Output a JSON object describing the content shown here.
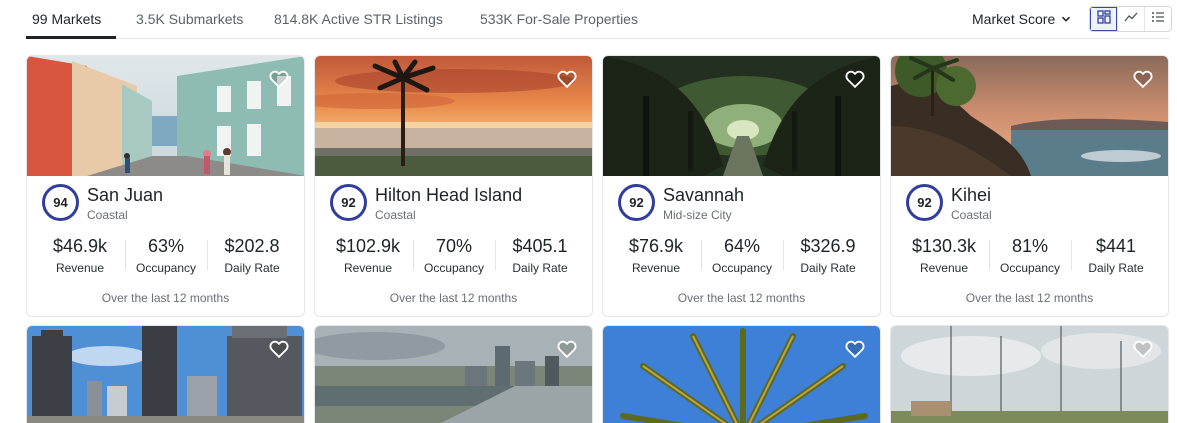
{
  "tabs": [
    {
      "label": "99 Markets"
    },
    {
      "label": "3.5K Submarkets"
    },
    {
      "label": "814.8K Active STR Listings"
    },
    {
      "label": "533K For-Sale Properties"
    }
  ],
  "sort": {
    "label": "Market Score"
  },
  "view_buttons": [
    {
      "icon": "grid-icon",
      "active": true
    },
    {
      "icon": "trend-chart-icon",
      "active": false
    },
    {
      "icon": "list-icon",
      "active": false
    }
  ],
  "stat_labels": {
    "revenue": "Revenue",
    "occupancy": "Occupancy",
    "daily_rate": "Daily Rate"
  },
  "markets": [
    {
      "score": "94",
      "name": "San Juan",
      "type": "Coastal",
      "revenue": "$46.9k",
      "occupancy": "63%",
      "daily_rate": "$202.8",
      "period": "Over the last 12 months",
      "photo": "street-photo"
    },
    {
      "score": "92",
      "name": "Hilton Head Island",
      "type": "Coastal",
      "revenue": "$102.9k",
      "occupancy": "70%",
      "daily_rate": "$405.1",
      "period": "Over the last 12 months",
      "photo": "beach-sunset-photo"
    },
    {
      "score": "92",
      "name": "Savannah",
      "type": "Mid-size City",
      "revenue": "$76.9k",
      "occupancy": "64%",
      "daily_rate": "$326.9",
      "period": "Over the last 12 months",
      "photo": "oak-alley-photo"
    },
    {
      "score": "92",
      "name": "Kihei",
      "type": "Coastal",
      "revenue": "$130.3k",
      "occupancy": "81%",
      "daily_rate": "$441",
      "period": "Over the last 12 months",
      "photo": "lava-coast-photo"
    }
  ],
  "more_markets": [
    {
      "photo": "skyscrapers-photo"
    },
    {
      "photo": "river-city-photo"
    },
    {
      "photo": "palm-tree-photo"
    },
    {
      "photo": "marina-photo"
    }
  ]
}
